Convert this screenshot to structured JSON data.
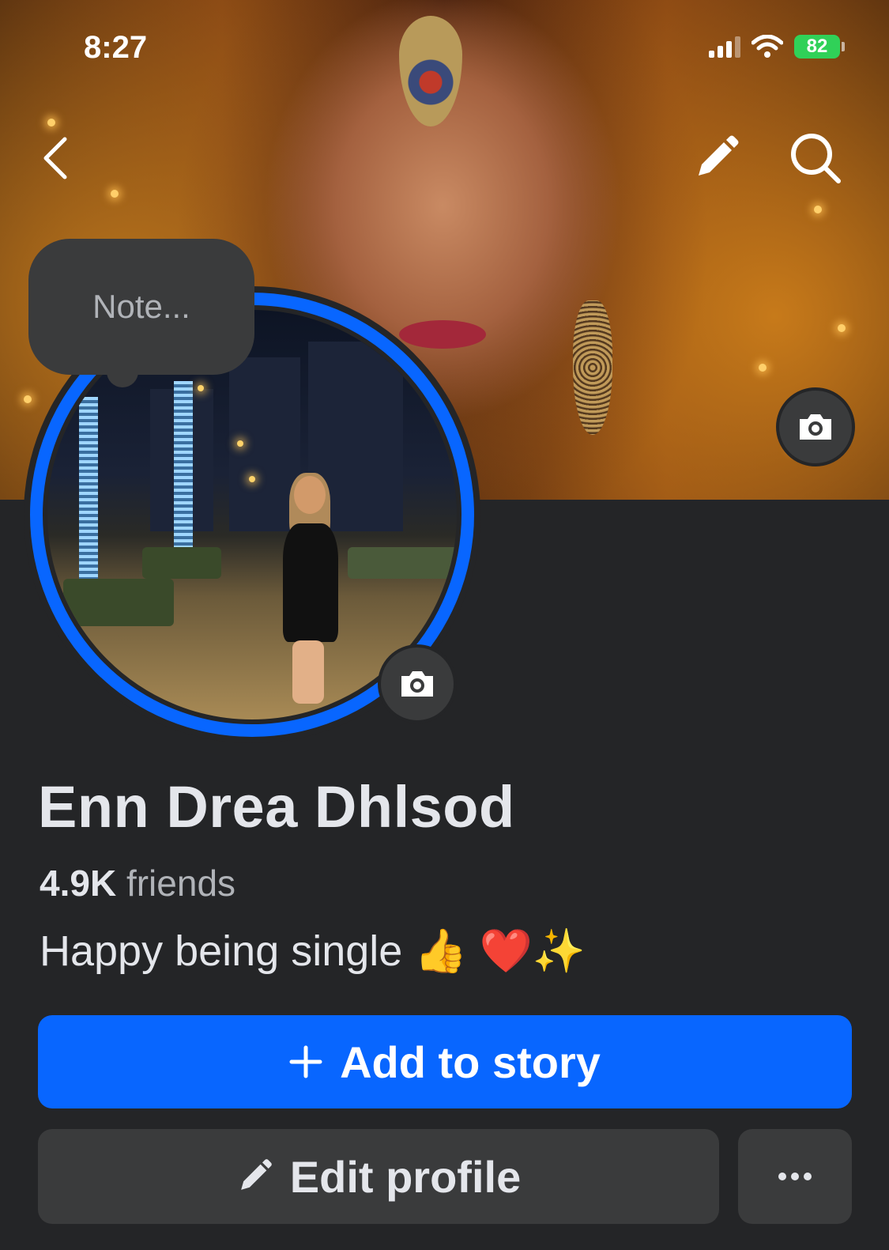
{
  "status_bar": {
    "time": "8:27",
    "battery": "82",
    "icons": [
      "signal-icon",
      "wifi-icon",
      "battery-charging-icon"
    ]
  },
  "nav": {
    "icons": [
      "back-arrow-icon",
      "pencil-icon",
      "search-icon"
    ]
  },
  "note": {
    "placeholder": "Note..."
  },
  "profile": {
    "name": "Enn Drea Dhlsod",
    "friends_count": "4.9K",
    "friends_label": "friends",
    "bio": "Happy being single 👍 ❤️✨"
  },
  "actions": {
    "add_story_label": "Add to story",
    "edit_profile_label": "Edit profile",
    "more_icon": "more-dots-icon"
  },
  "colors": {
    "accent": "#0866ff",
    "background": "#242527",
    "button_secondary": "#3a3b3c",
    "battery_green": "#30d158"
  }
}
